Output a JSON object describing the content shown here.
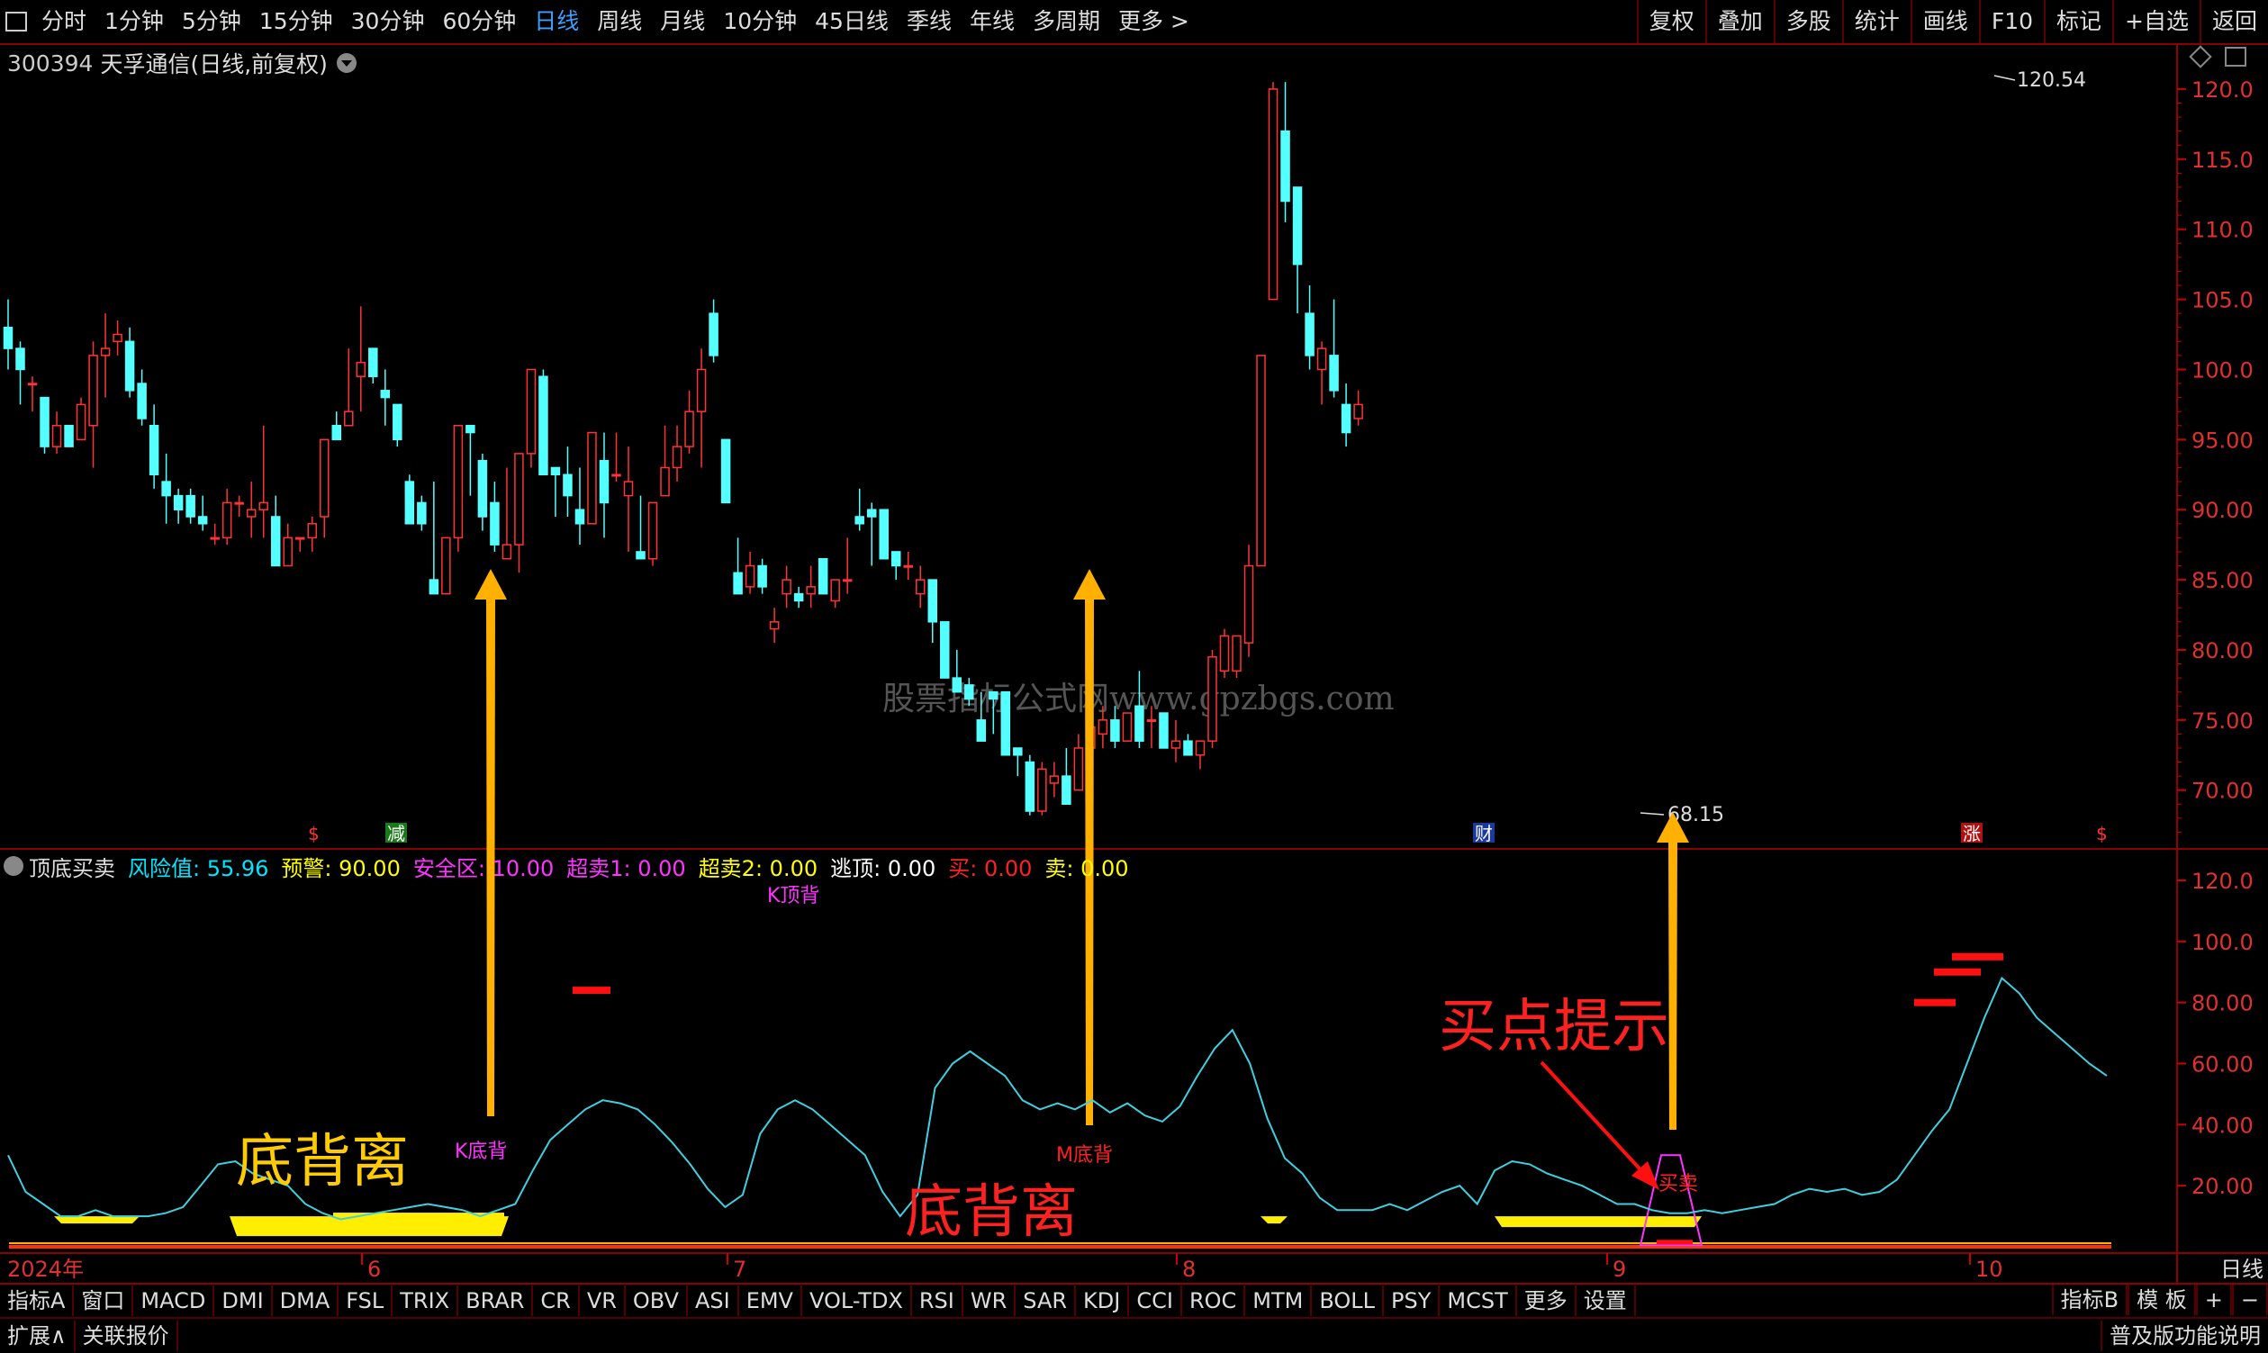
{
  "toolbar": {
    "timeframes": [
      "分时",
      "1分钟",
      "5分钟",
      "15分钟",
      "30分钟",
      "60分钟",
      "日线",
      "周线",
      "月线",
      "10分钟",
      "45日线",
      "季线",
      "年线",
      "多周期",
      "更多 >"
    ],
    "active_index": 6,
    "right_buttons": [
      "复权",
      "叠加",
      "多股",
      "统计",
      "画线",
      "F10",
      "标记",
      "+自选",
      "返回"
    ]
  },
  "header": {
    "code": "300394",
    "name": "天孚通信(日线,前复权)"
  },
  "price_axis": [
    "120.0",
    "115.0",
    "110.0",
    "105.0",
    "100.0",
    "95.00",
    "90.00",
    "85.00",
    "80.00",
    "75.00",
    "70.00"
  ],
  "ind_axis": [
    "120.0",
    "100.0",
    "80.00",
    "60.00",
    "40.00",
    "20.00"
  ],
  "annotations": {
    "high": "120.54",
    "low": "68.15",
    "markers": [
      "$",
      "减",
      "财",
      "涨",
      "$"
    ],
    "k_bottom": "K底背",
    "k_top": "K顶背",
    "m_bottom": "M底背",
    "buy_sell": "买卖",
    "divergence": "底背离",
    "buy_hint": "买点提示",
    "watermark": "股票指标公式网www.gpzbgs.com"
  },
  "indicator": {
    "name": "顶底买卖",
    "values": [
      {
        "label": "风险值: 55.96",
        "color": "#00e5ff"
      },
      {
        "label": "预警: 90.00",
        "color": "#ffff00"
      },
      {
        "label": "安全区: 10.00",
        "color": "#ff33ff"
      },
      {
        "label": "超卖1: 0.00",
        "color": "#ff33ff"
      },
      {
        "label": "超卖2: 0.00",
        "color": "#ffff00"
      },
      {
        "label": "逃顶: 0.00",
        "color": "#ffffff"
      },
      {
        "label": "买: 0.00",
        "color": "#ff2020"
      },
      {
        "label": "卖: 0.00",
        "color": "#ffff00"
      }
    ]
  },
  "time_axis": {
    "year": "2024年",
    "months": [
      "6",
      "7",
      "8",
      "9",
      "10"
    ],
    "period": "日线"
  },
  "bottom_tabs": [
    "指标A",
    "窗口",
    "MACD",
    "DMI",
    "DMA",
    "FSL",
    "TRIX",
    "BRAR",
    "CR",
    "VR",
    "OBV",
    "ASI",
    "EMV",
    "VOL-TDX",
    "RSI",
    "WR",
    "SAR",
    "KDJ",
    "CCI",
    "ROC",
    "MTM",
    "BOLL",
    "PSY",
    "MCST",
    "更多",
    "设置"
  ],
  "bottom_right": [
    "指标B",
    "模 板",
    "+",
    "−"
  ],
  "status": {
    "left": [
      "扩展∧",
      "关联报价"
    ],
    "right": "普及版功能说明"
  },
  "chart_data": {
    "type": "candlestick",
    "price_range": [
      66.0,
      122.5
    ],
    "candles": [
      [
        103,
        105,
        100,
        101.5
      ],
      [
        101.5,
        102,
        97.5,
        100
      ],
      [
        99,
        99.5,
        97,
        99
      ],
      [
        98,
        98,
        94,
        94.5
      ],
      [
        94.5,
        97,
        94,
        96
      ],
      [
        96,
        96,
        94.5,
        94.5
      ],
      [
        95,
        98,
        95,
        97.5
      ],
      [
        96,
        102,
        93,
        101
      ],
      [
        101,
        104,
        98,
        101.5
      ],
      [
        102,
        103.5,
        101,
        102.5
      ],
      [
        102,
        103,
        98,
        98.5
      ],
      [
        99,
        100,
        96,
        96.5
      ],
      [
        96,
        97.5,
        91.5,
        92.5
      ],
      [
        92,
        94,
        89,
        91
      ],
      [
        91,
        91.5,
        89,
        90
      ],
      [
        91,
        91.5,
        89,
        89.5
      ],
      [
        89.5,
        91,
        88.5,
        89
      ],
      [
        88,
        89,
        87.5,
        88
      ],
      [
        88,
        91.5,
        87.5,
        90.5
      ],
      [
        90.5,
        91,
        89.5,
        90.5
      ],
      [
        89.5,
        92,
        88,
        90
      ],
      [
        90,
        96,
        88,
        90.5
      ],
      [
        89.5,
        91,
        86,
        86
      ],
      [
        86,
        89,
        86,
        88
      ],
      [
        88,
        88,
        87,
        88
      ],
      [
        88,
        89.5,
        87,
        89
      ],
      [
        89.5,
        95,
        88,
        95
      ],
      [
        96,
        97,
        95,
        95
      ],
      [
        96,
        101.5,
        96,
        97
      ],
      [
        99.5,
        104.5,
        97,
        100.5
      ],
      [
        101.5,
        101.5,
        99,
        99.5
      ],
      [
        98.5,
        100,
        96,
        98
      ],
      [
        97.5,
        97.5,
        94.5,
        95
      ],
      [
        92,
        92.5,
        89,
        89
      ],
      [
        90.5,
        91,
        88.5,
        89
      ],
      [
        85,
        92,
        84,
        84
      ],
      [
        84,
        88,
        84,
        88
      ],
      [
        88,
        91,
        87,
        96
      ],
      [
        96,
        95.5,
        91,
        95.5
      ],
      [
        93.5,
        94,
        88.5,
        89.5
      ],
      [
        90.5,
        92,
        87,
        87.5
      ],
      [
        86.5,
        93,
        86.5,
        87.5
      ],
      [
        87.5,
        94,
        85.5,
        94
      ],
      [
        94,
        100,
        93,
        100
      ],
      [
        99.5,
        100,
        92.5,
        92.5
      ],
      [
        93,
        93,
        89.5,
        92.5
      ],
      [
        92.5,
        94.5,
        89.5,
        91
      ],
      [
        90,
        93,
        87.5,
        89
      ],
      [
        89,
        95.5,
        89,
        95.5
      ],
      [
        93.5,
        95.5,
        88,
        90.5
      ],
      [
        92.5,
        95.5,
        92,
        92.5
      ],
      [
        91,
        94.5,
        87,
        92
      ],
      [
        87,
        91,
        86.5,
        86.5
      ],
      [
        86.5,
        90,
        86,
        90.5
      ],
      [
        91,
        96,
        91,
        93
      ],
      [
        93,
        96,
        92,
        94.5
      ],
      [
        94.5,
        98.5,
        94,
        97
      ],
      [
        97,
        101.5,
        93,
        100
      ],
      [
        104,
        105,
        100.5,
        101
      ],
      [
        95,
        95,
        90.5,
        90.5
      ],
      [
        85.5,
        88,
        84,
        84
      ],
      [
        84.5,
        87,
        84,
        86
      ],
      [
        86,
        86.5,
        84,
        84.5
      ],
      [
        81.5,
        83,
        80.5,
        82
      ],
      [
        84,
        86,
        83,
        85
      ],
      [
        84,
        84.5,
        83,
        83.5
      ],
      [
        84,
        86,
        83,
        84.5
      ],
      [
        86.5,
        86.5,
        84,
        84
      ],
      [
        83.5,
        85,
        83,
        85
      ],
      [
        85,
        88,
        84,
        85
      ],
      [
        89.5,
        91.5,
        88.5,
        89
      ],
      [
        90,
        90.5,
        86,
        89.5
      ],
      [
        90,
        90,
        86.5,
        86.5
      ],
      [
        87,
        87,
        85,
        86
      ],
      [
        86,
        87,
        85,
        86
      ],
      [
        84,
        86,
        83,
        85
      ],
      [
        85,
        85,
        80.5,
        82
      ],
      [
        82,
        82,
        78,
        78
      ],
      [
        78,
        80,
        77.5,
        77
      ],
      [
        77.5,
        78,
        76,
        76.5
      ],
      [
        75,
        77,
        74,
        73.5
      ],
      [
        77,
        77,
        74,
        76.5
      ],
      [
        77,
        77,
        73,
        72.5
      ],
      [
        73,
        73,
        71,
        72.5
      ],
      [
        72,
        72.5,
        68.2,
        68.5
      ],
      [
        68.5,
        72,
        68.2,
        71.5
      ],
      [
        70.5,
        72,
        69.5,
        71
      ],
      [
        71,
        73,
        69.5,
        69
      ],
      [
        70,
        74,
        70,
        73
      ],
      [
        73,
        75,
        71,
        74.5
      ],
      [
        74,
        76,
        73,
        75
      ],
      [
        75,
        76,
        73,
        73.5
      ],
      [
        73.5,
        75.5,
        73.5,
        75.5
      ],
      [
        76,
        78.5,
        73,
        73.5
      ],
      [
        75,
        76,
        73,
        75
      ],
      [
        75.5,
        75.5,
        73,
        73
      ],
      [
        73,
        75,
        72,
        73.5
      ],
      [
        73.5,
        74,
        72.5,
        72.5
      ],
      [
        72.5,
        73,
        71.5,
        73.5
      ],
      [
        73.5,
        80,
        73,
        79.5
      ],
      [
        78.5,
        81.5,
        78,
        81
      ],
      [
        78.5,
        81,
        78,
        81
      ],
      [
        80.5,
        87.5,
        79.5,
        86
      ],
      [
        86,
        101,
        86,
        101
      ],
      [
        105,
        120.5,
        105,
        120
      ],
      [
        117,
        120.5,
        110.5,
        112
      ],
      [
        113,
        113,
        104,
        107.5
      ],
      [
        104,
        106,
        100,
        101
      ],
      [
        100,
        102,
        97.5,
        101.5
      ],
      [
        101,
        105,
        98,
        98.5
      ],
      [
        97.5,
        99,
        94.5,
        95.5
      ],
      [
        96.5,
        98.5,
        96,
        97.5
      ]
    ],
    "indicator_line": [
      30,
      18,
      14,
      10,
      10,
      12,
      10,
      10,
      10,
      11,
      13,
      20,
      27,
      28,
      24,
      22,
      20,
      14,
      11,
      9,
      10,
      11,
      12,
      13,
      14,
      13,
      12,
      10,
      12,
      14,
      25,
      35,
      40,
      45,
      48,
      47,
      45,
      40,
      34,
      27,
      19,
      13,
      17,
      37,
      45,
      48,
      45,
      40,
      35,
      30,
      18,
      10,
      17,
      52,
      60,
      64,
      60,
      56,
      48,
      45,
      47,
      45,
      48,
      44,
      47,
      43,
      41,
      46,
      56,
      65,
      71,
      60,
      42,
      29,
      24,
      16,
      12,
      12,
      12,
      14,
      12,
      15,
      18,
      20,
      14,
      25,
      28,
      27,
      24,
      22,
      20,
      17,
      14,
      14,
      12,
      11,
      11,
      12,
      11,
      12,
      13,
      14,
      17,
      19,
      18,
      19,
      17,
      18,
      22,
      30,
      38,
      45,
      60,
      75,
      88,
      83,
      75,
      70,
      65,
      60,
      56
    ]
  }
}
